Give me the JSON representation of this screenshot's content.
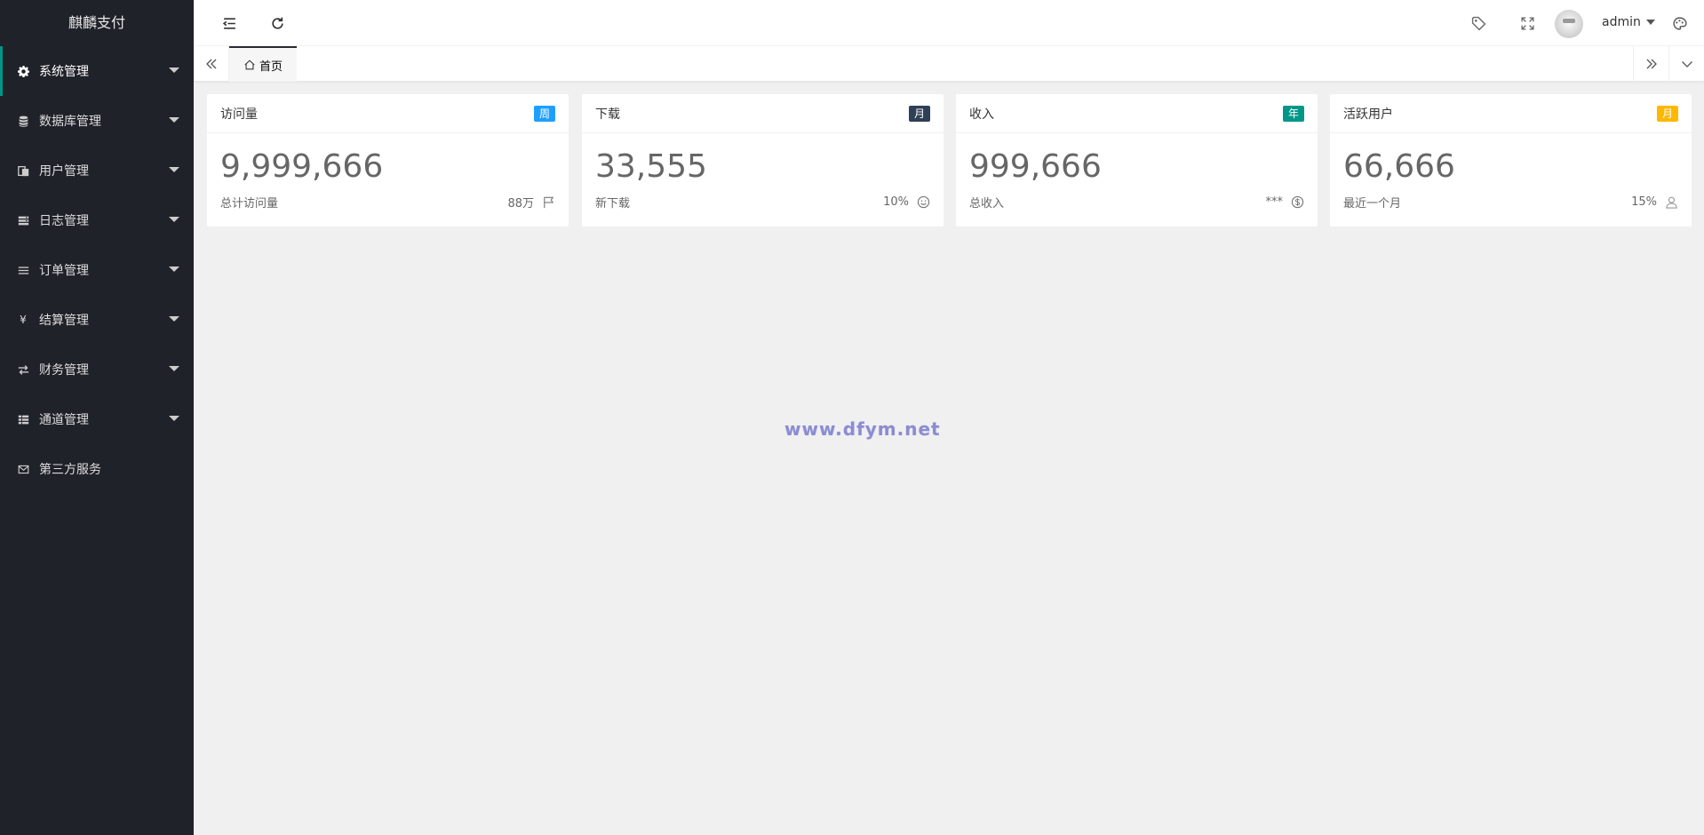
{
  "app": {
    "title": "麒麟支付"
  },
  "sidebar": {
    "items": [
      {
        "label": "系统管理",
        "icon": "gear-icon"
      },
      {
        "label": "数据库管理",
        "icon": "database-icon"
      },
      {
        "label": "用户管理",
        "icon": "users-icon"
      },
      {
        "label": "日志管理",
        "icon": "log-icon"
      },
      {
        "label": "订单管理",
        "icon": "list-icon"
      },
      {
        "label": "结算管理",
        "icon": "yen-icon",
        "glyph": "¥"
      },
      {
        "label": "财务管理",
        "icon": "transfer-icon"
      },
      {
        "label": "通道管理",
        "icon": "channel-icon"
      },
      {
        "label": "第三方服务",
        "icon": "mail-icon"
      }
    ]
  },
  "header": {
    "user_name": "admin"
  },
  "tabs": {
    "home_label": "首页"
  },
  "cards": [
    {
      "title": "访问量",
      "badge": "周",
      "badge_color": "#1e9fff",
      "value": "9,999,666",
      "subtitle": "总计访问量",
      "right_text": "88万",
      "icon": "flag-icon"
    },
    {
      "title": "下载",
      "badge": "月",
      "badge_color": "#2f4056",
      "value": "33,555",
      "subtitle": "新下载",
      "right_text": "10%",
      "icon": "smile-icon"
    },
    {
      "title": "收入",
      "badge": "年",
      "badge_color": "#009688",
      "value": "999,666",
      "subtitle": "总收入",
      "right_text": "***",
      "icon": "dollar-icon"
    },
    {
      "title": "活跃用户",
      "badge": "月",
      "badge_color": "#ffb800",
      "value": "66,666",
      "subtitle": "最近一个月",
      "right_text": "15%",
      "icon": "user-icon"
    }
  ],
  "watermark": "www.dfym.net"
}
